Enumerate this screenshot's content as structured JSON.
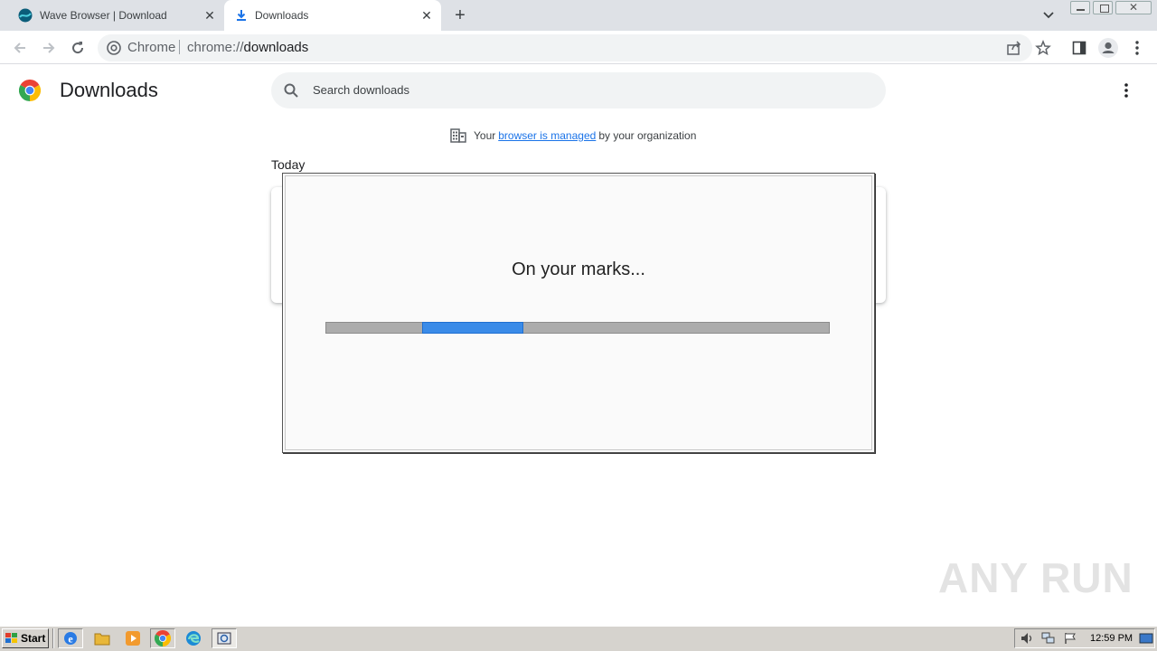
{
  "tabs": [
    {
      "label": "Wave Browser | Download",
      "icon": "wave-logo-icon"
    },
    {
      "label": "Downloads",
      "icon": "download-icon",
      "active": true
    }
  ],
  "omnibox": {
    "site_chip": "Chrome",
    "url_scheme": "chrome://",
    "url_path": "downloads"
  },
  "page": {
    "title": "Downloads",
    "search_placeholder": "Search downloads",
    "managed": {
      "prefix": "Your",
      "link": "browser is managed",
      "suffix": "by your organization"
    },
    "section": "Today"
  },
  "installer": {
    "status": "On your marks...",
    "progress": 0.2
  },
  "watermark": "ANY RUN",
  "taskbar": {
    "start_label": "Start",
    "clock": "12:59 PM"
  },
  "colors": {
    "accent": "#1a73e8",
    "progress_fill": "#3a8be8"
  }
}
